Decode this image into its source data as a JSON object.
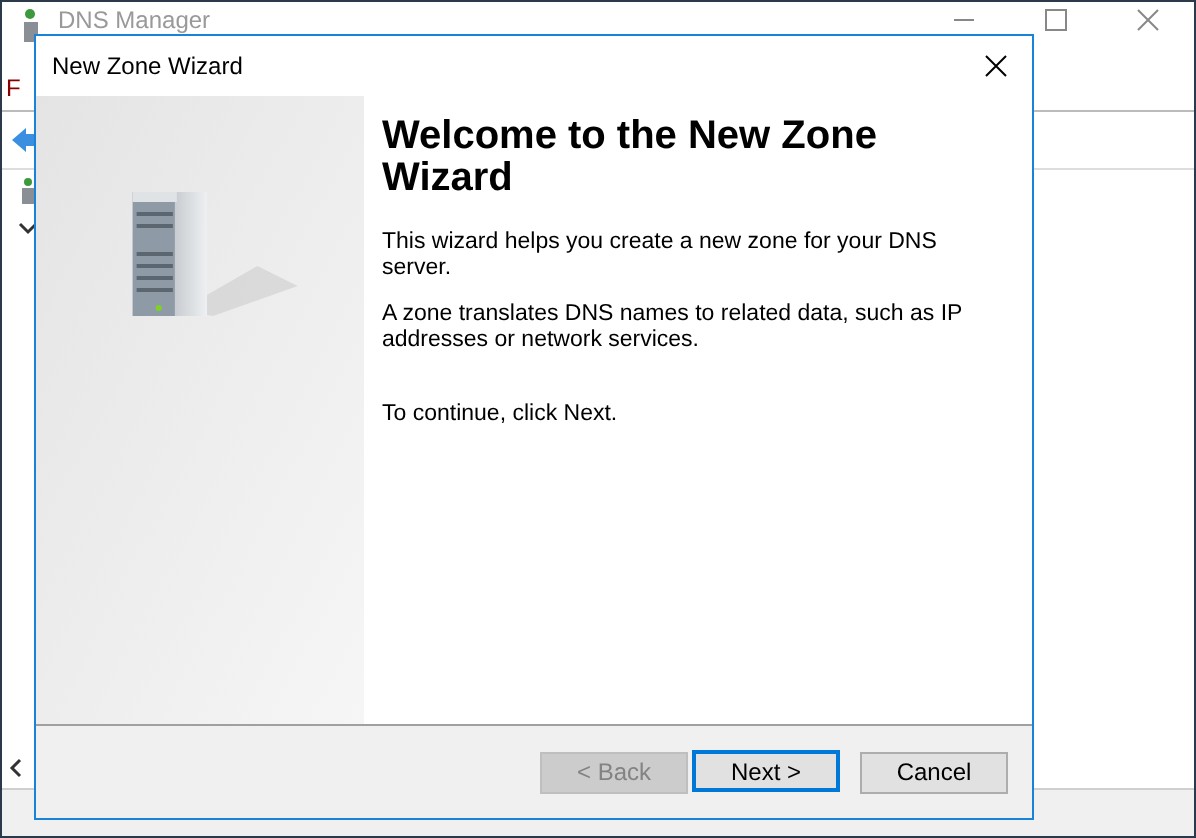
{
  "background_window": {
    "title": "DNS Manager",
    "menu_letter": "F"
  },
  "dialog": {
    "title": "New Zone Wizard",
    "heading": "Welcome to the New Zone Wizard",
    "paragraphs": [
      "This wizard helps you create a new zone for your DNS server.",
      "A zone translates DNS names to related data, such as IP addresses or network services.",
      "To continue, click Next."
    ],
    "buttons": [
      {
        "label": "< Back",
        "disabled": true,
        "default": false
      },
      {
        "label": "Next >",
        "disabled": false,
        "default": true
      },
      {
        "label": "Cancel",
        "disabled": false,
        "default": false
      }
    ]
  }
}
